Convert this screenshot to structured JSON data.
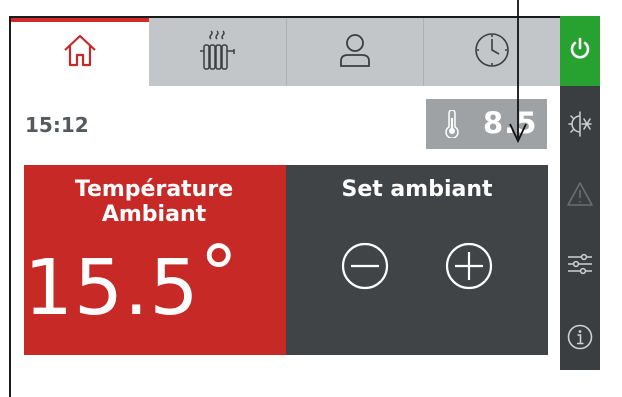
{
  "colors": {
    "accent_red": "#c72a26",
    "tab_active_marker": "#d12a2a",
    "power_green": "#27a12f",
    "sidebar_dark": "#3b3e40",
    "panel_dark": "#404447",
    "tab_inactive": "#c3c6c8",
    "chip_gray": "#9ea2a5"
  },
  "tabs": [
    {
      "icon": "home-icon",
      "active": true
    },
    {
      "icon": "radiator-icon",
      "active": false
    },
    {
      "icon": "user-icon",
      "active": false
    },
    {
      "icon": "clock-icon",
      "active": false
    }
  ],
  "sidebar": [
    {
      "icon": "power-icon",
      "active": true
    },
    {
      "icon": "sun-snowflake-icon",
      "active": false
    },
    {
      "icon": "warning-icon",
      "active": false
    },
    {
      "icon": "settings-sliders-icon",
      "active": false
    },
    {
      "icon": "info-icon",
      "active": false
    }
  ],
  "status": {
    "time": "15:12",
    "outdoor_temp": "8.5",
    "thermometer_icon": "thermometer-icon"
  },
  "ambient_panel": {
    "title_line1": "Température",
    "title_line2": "Ambiant",
    "value": "15.5",
    "unit": "°"
  },
  "setpoint_panel": {
    "title": "Set ambiant",
    "decrease_icon": "minus-circle-icon",
    "increase_icon": "plus-circle-icon"
  }
}
